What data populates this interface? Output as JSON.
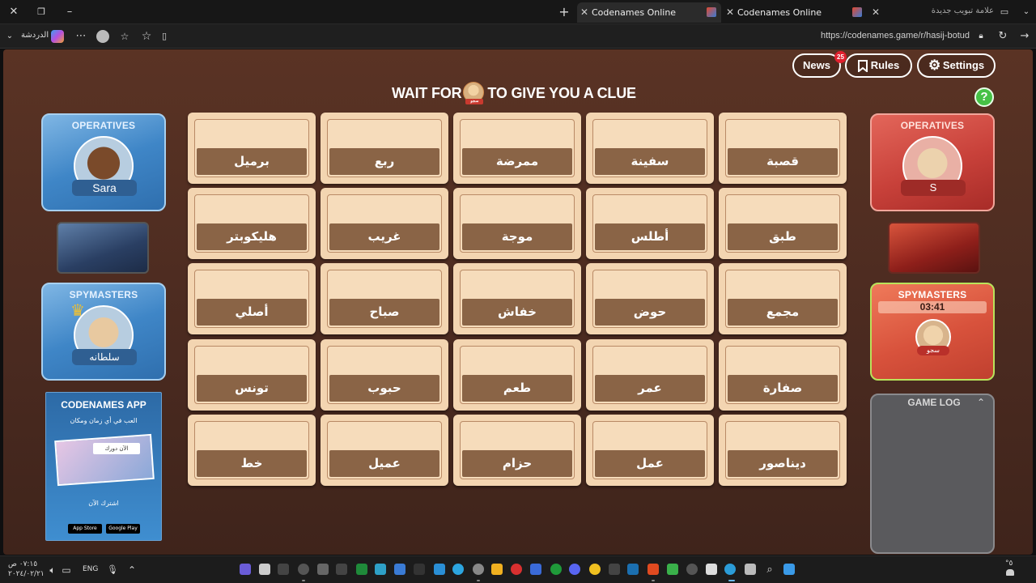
{
  "browser": {
    "tabs": [
      {
        "title": "Codenames Online",
        "active": true
      },
      {
        "title": "Codenames Online",
        "active": false
      }
    ],
    "new_tab_label": "علامة تبويب جديدة",
    "url": "https://codenames.game/r/hasij-botud",
    "chat_label": "الدردشة"
  },
  "game": {
    "top_buttons": {
      "news": "News",
      "news_badge": "25",
      "rules": "Rules",
      "settings": "Settings"
    },
    "headline_before": "WAIT FOR",
    "headline_after": "TO GIVE YOU A CLUE",
    "spymaster_tag": "سجو",
    "help": "?",
    "blue_team": {
      "operatives_title": "OPERATIVES",
      "operative_name": "Sara",
      "spymasters_title": "SPYMASTERS",
      "spymaster_name": "سلطانه"
    },
    "red_team": {
      "operatives_title": "OPERATIVES",
      "operative_name": "S",
      "spymasters_title": "SPYMASTERS",
      "timer": "03:41",
      "spymaster_name": "سجو"
    },
    "board": [
      [
        "برميل",
        "ربع",
        "ممرضة",
        "سفينة",
        "قصبة"
      ],
      [
        "هليكوبتر",
        "غريب",
        "موجة",
        "أطلس",
        "طبق"
      ],
      [
        "أصلي",
        "صباح",
        "خفاش",
        "حوض",
        "مجمع"
      ],
      [
        "تونس",
        "حبوب",
        "طعم",
        "عمر",
        "صفارة"
      ],
      [
        "خط",
        "عميل",
        "حزام",
        "عمل",
        "ديناصور"
      ]
    ],
    "app_ad": {
      "title": "CODENAMES APP",
      "subtitle": "العب في أي زمان ومكان",
      "badge": "الآن دورك",
      "cta": "اشترك الآن",
      "store1": "App Store",
      "store2": "Google Play"
    },
    "game_log_title": "GAME LOG"
  },
  "taskbar": {
    "lang": "ENG",
    "time": "٠٧:١٥ ص",
    "date": "٢٠٢٤/٠٢/٢١",
    "weather": "°٥"
  },
  "colors": {
    "blue_team": "#3f86c7",
    "red_team": "#c8413a",
    "card": "#f3d5b1",
    "word_bar": "#8a6446"
  }
}
